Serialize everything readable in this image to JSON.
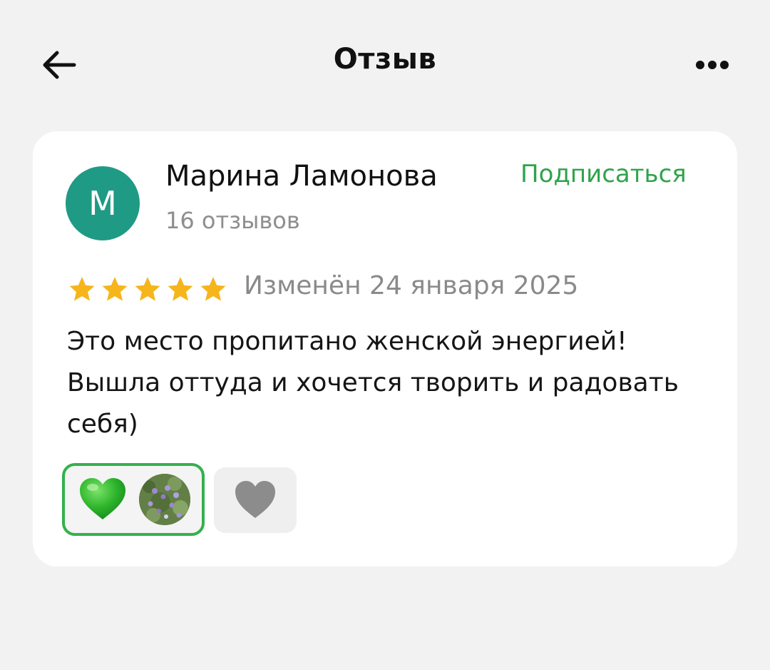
{
  "header": {
    "title": "Отзыв",
    "back_icon": "arrow-left-icon",
    "more_icon": "more-dots-icon"
  },
  "review": {
    "author": {
      "avatar_letter": "М",
      "avatar_color": "#1f9a85",
      "name": "Марина Ламонова",
      "reviews_count": "16 отзывов"
    },
    "subscribe_label": "Подписаться",
    "rating": 5,
    "rating_max": 5,
    "date": "Изменён 24 января 2025",
    "text": "Это место пропитано женской энергией! Вышла оттуда и хочется творить и радовать себя)",
    "reactions": {
      "active": {
        "icon": "green-heart-icon",
        "has_user_photo": true
      },
      "inactive": {
        "icon": "gray-heart-icon"
      }
    }
  },
  "colors": {
    "accent_green": "#2ea44a",
    "star_gold": "#f5b51b",
    "background": "#f2f2f2"
  }
}
